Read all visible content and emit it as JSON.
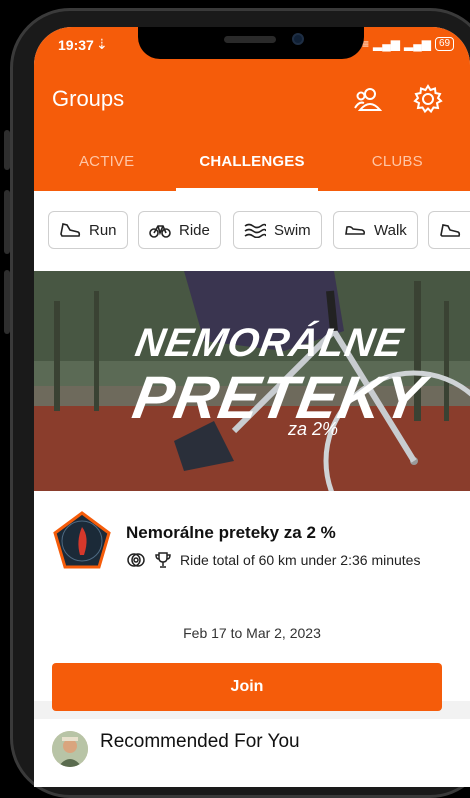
{
  "status_bar": {
    "time": "19:37",
    "battery": "69"
  },
  "header": {
    "title": "Groups"
  },
  "tabs": [
    {
      "label": "ACTIVE"
    },
    {
      "label": "CHALLENGES"
    },
    {
      "label": "CLUBS"
    }
  ],
  "filters": [
    {
      "label": "Run",
      "icon": "shoe-icon"
    },
    {
      "label": "Ride",
      "icon": "bike-icon"
    },
    {
      "label": "Swim",
      "icon": "waves-icon"
    },
    {
      "label": "Walk",
      "icon": "walk-shoe-icon"
    }
  ],
  "hero": {
    "line1": "NEMORÁLNE",
    "line2": "PRETEKY",
    "line3": "za 2%"
  },
  "challenge": {
    "name": "Nemorálne preteky za 2 %",
    "description": "Ride total of 60 km under 2:36 minutes",
    "dates": "Feb 17 to Mar 2, 2023",
    "join_label": "Join"
  },
  "recommended": {
    "title": "Recommended For You"
  },
  "colors": {
    "accent": "#f55c0a",
    "background": "#f2f2f2"
  }
}
